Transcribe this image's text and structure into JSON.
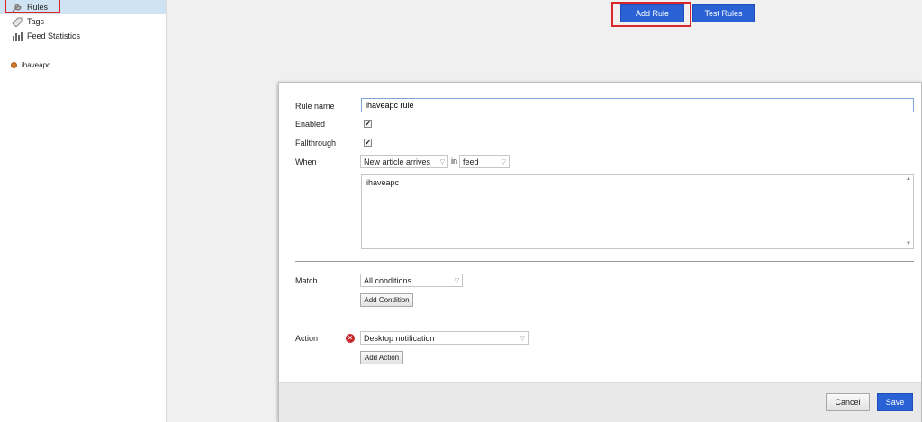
{
  "sidebar": {
    "items": [
      {
        "label": "Rules",
        "icon": "wrench-icon",
        "active": true
      },
      {
        "label": "Tags",
        "icon": "tag-icon",
        "active": false
      },
      {
        "label": "Feed Statistics",
        "icon": "bar-chart-icon",
        "active": false
      }
    ],
    "feed": {
      "label": "ihaveapc",
      "icon": "feed-dot-icon"
    }
  },
  "toolbar": {
    "add_rule_label": "Add Rule",
    "test_rules_label": "Test Rules"
  },
  "dialog": {
    "rule_name_label": "Rule name",
    "rule_name_value": "ihaveapc rule",
    "enabled_label": "Enabled",
    "enabled_checked": true,
    "fallthrough_label": "Fallthrough",
    "fallthrough_checked": true,
    "when_label": "When",
    "when_event": "New article arrives",
    "in_label": "in",
    "when_source": "feed",
    "feed_textarea_value": "ihaveapc",
    "match_label": "Match",
    "match_value": "All conditions",
    "add_condition_label": "Add Condition",
    "action_label": "Action",
    "action_value": "Desktop notification",
    "add_action_label": "Add Action",
    "cancel_label": "Cancel",
    "save_label": "Save"
  },
  "colors": {
    "accent_blue": "#2a62d6",
    "highlight_red": "#d9262b",
    "sidebar_active": "#cfe3f3"
  }
}
